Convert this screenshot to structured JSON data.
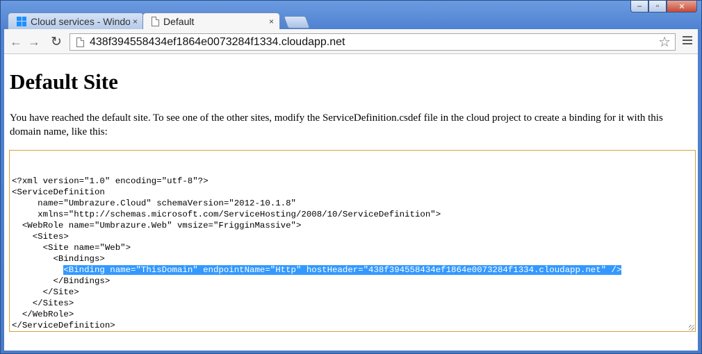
{
  "tabs": [
    {
      "title": "Cloud services - Windows Azure",
      "active": false
    },
    {
      "title": "Default",
      "active": true
    }
  ],
  "tab_close": "×",
  "caption": {
    "minimize": "‒",
    "maximize": "▫",
    "close": "✕"
  },
  "toolbar": {
    "back": "←",
    "forward": "→",
    "reload": "↻",
    "url": "438f394558434ef1864e0073284f1334.cloudapp.net",
    "star": "☆"
  },
  "page": {
    "heading": "Default Site",
    "paragraph": "You have reached the default site. To see one of the other sites, modify the ServiceDefinition.csdef file in the cloud project to create a binding for it with this domain name, like this:",
    "code_lines": [
      "<?xml version=\"1.0\" encoding=\"utf-8\"?>",
      "<ServiceDefinition",
      "     name=\"Umbrazure.Cloud\" schemaVersion=\"2012-10.1.8\"",
      "     xmlns=\"http://schemas.microsoft.com/ServiceHosting/2008/10/ServiceDefinition\">",
      "  <WebRole name=\"Umbrazure.Web\" vmsize=\"FrigginMassive\">",
      "    <Sites>",
      "      <Site name=\"Web\">",
      "        <Bindings>",
      "          <Binding name=\"ThisDomain\" endpointName=\"Http\" hostHeader=\"438f394558434ef1864e0073284f1334.cloudapp.net\" />",
      "        </Bindings>",
      "      </Site>",
      "    </Sites>",
      "  </WebRole>",
      "</ServiceDefinition>"
    ],
    "selected_line_index": 8
  },
  "colors": {
    "selection": "#3399ff",
    "textarea_border": "#d8a23a",
    "window_frame": "#4a7bc8"
  }
}
